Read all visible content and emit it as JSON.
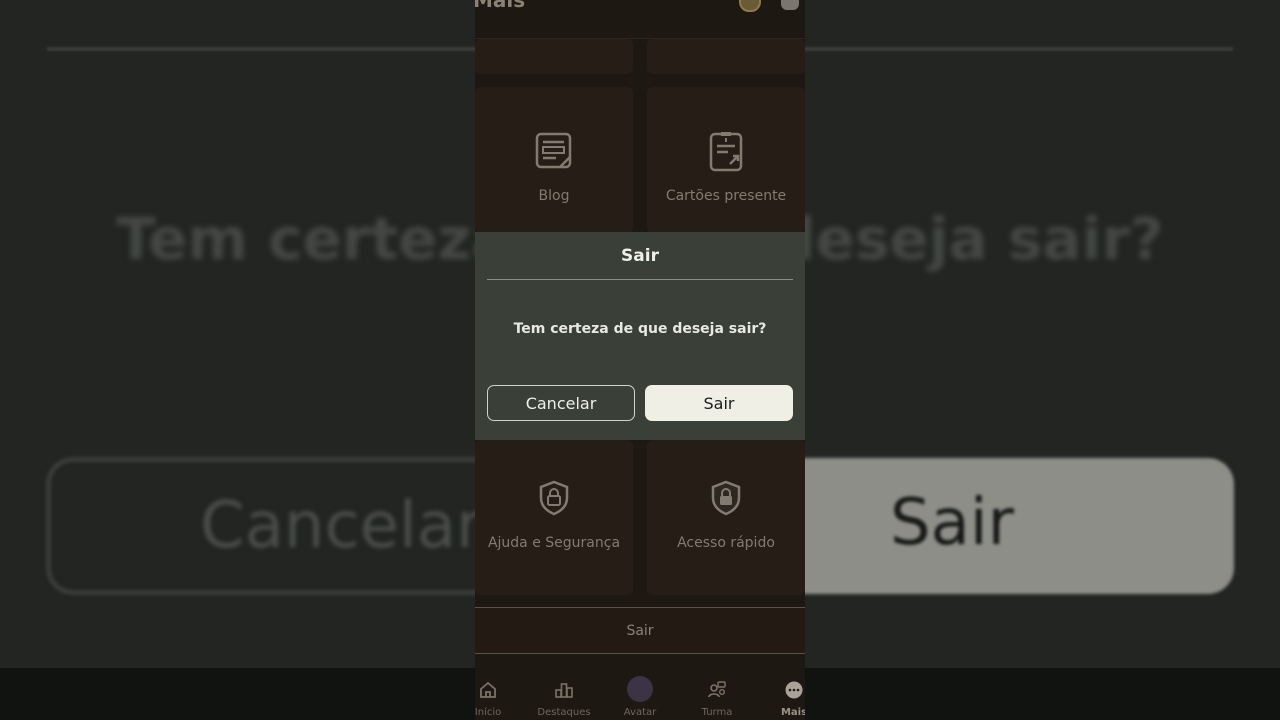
{
  "background": {
    "question": "Tem certeza de que deseja sair?",
    "cancel_label": "Cancelar",
    "sair_label": "Sair"
  },
  "header": {
    "title": "Mais"
  },
  "tiles": [
    {
      "label": "Blog",
      "icon": "blog-icon"
    },
    {
      "label": "Cartões presente",
      "icon": "gift-card-icon"
    },
    {
      "label": "Ajuda e Segurança",
      "icon": "shield-lock-icon"
    },
    {
      "label": "Acesso rápido",
      "icon": "quick-access-lock-icon"
    }
  ],
  "logout_row": {
    "label": "Sair"
  },
  "dialog": {
    "title": "Sair",
    "message": "Tem certeza de que deseja sair?",
    "cancel_label": "Cancelar",
    "confirm_label": "Sair"
  },
  "tabbar": {
    "items": [
      {
        "label": "Início",
        "icon": "home-icon"
      },
      {
        "label": "Destaques",
        "icon": "podium-icon"
      },
      {
        "label": "Avatar",
        "icon": "avatar-icon"
      },
      {
        "label": "Turma",
        "icon": "friends-icon"
      },
      {
        "label": "Mais",
        "icon": "more-icon"
      }
    ],
    "active": "Mais"
  },
  "colors": {
    "dialog_bg": "#3a4038",
    "confirm_bg": "#f0efe6",
    "app_bg": "#1e1812"
  }
}
